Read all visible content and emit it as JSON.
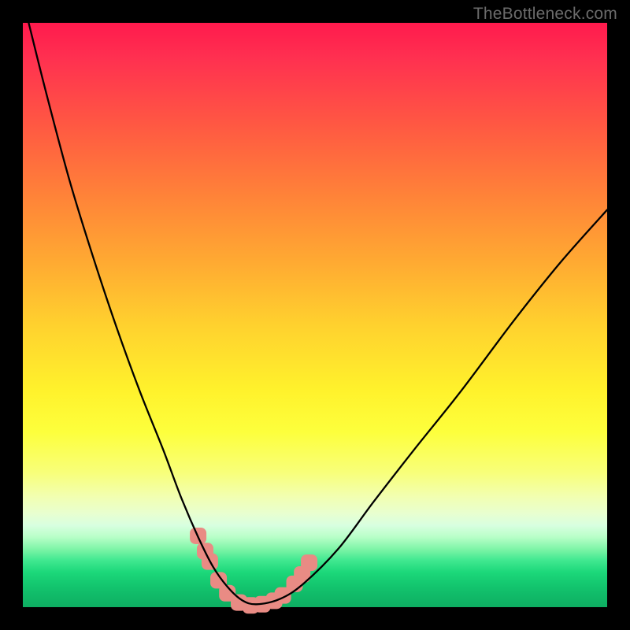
{
  "watermark": "TheBottleneck.com",
  "chart_data": {
    "type": "line",
    "title": "",
    "xlabel": "",
    "ylabel": "",
    "xlim": [
      0,
      100
    ],
    "ylim": [
      0,
      100
    ],
    "series": [
      {
        "name": "bottleneck-curve",
        "x": [
          1,
          4,
          8,
          12,
          16,
          20,
          24,
          27,
          30,
          32.5,
          35,
          37.5,
          40,
          44,
          48,
          54,
          60,
          67,
          75,
          84,
          92,
          100
        ],
        "values": [
          100,
          88,
          73,
          60,
          48,
          37,
          27,
          19,
          12,
          7,
          3.5,
          1.2,
          0.5,
          1.4,
          4,
          10,
          18,
          27,
          37,
          49,
          59,
          68
        ]
      }
    ],
    "markers": {
      "name": "highlight-points",
      "shape": "rounded-square",
      "color": "#e98b84",
      "points": [
        {
          "x": 30.0,
          "y": 12.2
        },
        {
          "x": 31.2,
          "y": 9.6
        },
        {
          "x": 32.0,
          "y": 7.8
        },
        {
          "x": 33.5,
          "y": 4.6
        },
        {
          "x": 35.0,
          "y": 2.4
        },
        {
          "x": 37.0,
          "y": 0.8
        },
        {
          "x": 39.0,
          "y": 0.3
        },
        {
          "x": 41.0,
          "y": 0.5
        },
        {
          "x": 43.0,
          "y": 1.1
        },
        {
          "x": 44.5,
          "y": 2.0
        },
        {
          "x": 46.5,
          "y": 4.0
        },
        {
          "x": 47.8,
          "y": 5.6
        },
        {
          "x": 49.0,
          "y": 7.6
        }
      ]
    }
  }
}
